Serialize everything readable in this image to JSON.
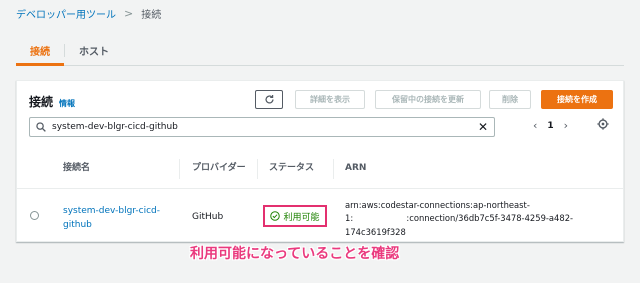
{
  "breadcrumb": {
    "parent": "デベロッパー用ツール",
    "separator": ">",
    "current": "接続"
  },
  "tabs": [
    {
      "label": "接続",
      "active": true
    },
    {
      "label": "ホスト",
      "active": false
    }
  ],
  "panel": {
    "title": "接続",
    "info": "情報",
    "buttons": {
      "view": "詳細を表示",
      "update": "保留中の接続を更新",
      "delete": "削除",
      "create": "接続を作成"
    },
    "search": {
      "value": "system-dev-blgr-cicd-github"
    },
    "pager": {
      "page": "1"
    }
  },
  "table": {
    "columns": {
      "name": "接続名",
      "provider": "プロバイダー",
      "status": "ステータス",
      "arn": "ARN"
    },
    "rows": [
      {
        "name": "system-dev-blgr-cicd-github",
        "provider": "GitHub",
        "status": "利用可能",
        "arn_line1": "arn:aws:codestar-connections:ap-northeast-",
        "arn_line2": "1:                    :connection/36db7c5f-3478-4259-a482-",
        "arn_line3": "174c3619f328"
      }
    ]
  },
  "annotation": "利用可能になっていることを確認",
  "colors": {
    "accent": "#ec7211",
    "link": "#0073bb",
    "success": "#1d8102",
    "highlight": "#e3306f"
  },
  "icons": {
    "refresh": "refresh-icon",
    "search": "search-icon",
    "clear": "close-icon",
    "settings": "gear-icon",
    "status": "check-circle-icon"
  }
}
